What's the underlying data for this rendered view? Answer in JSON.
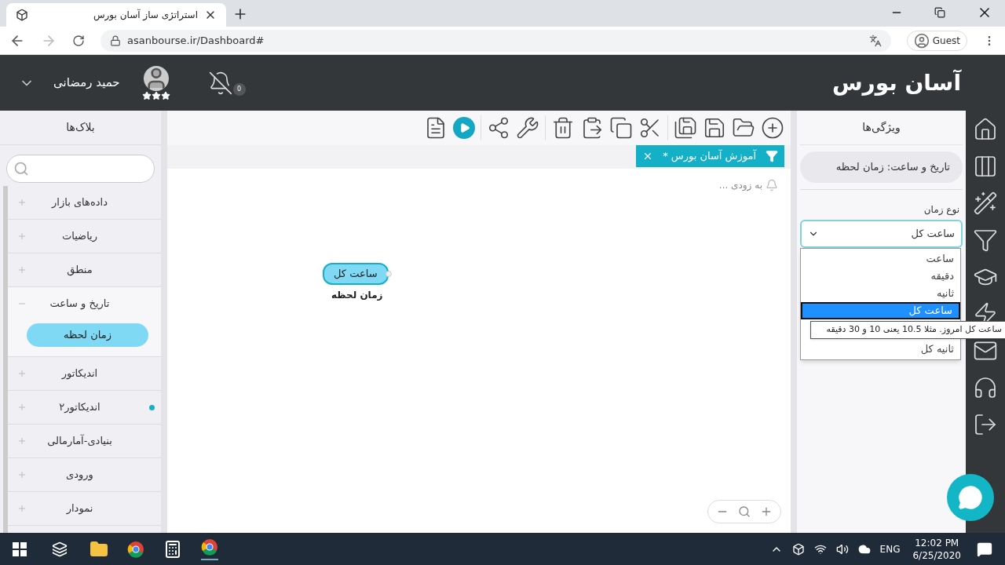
{
  "browser": {
    "tab_title": "استراتژی ساز آسان بورس",
    "url": "asanbourse.ir/Dashboard#",
    "profile": "Guest"
  },
  "header": {
    "logo": "آسان بورس",
    "user_name": "حمید رمضانی",
    "stars": 3,
    "notification_count": "0"
  },
  "blocks_panel": {
    "title": "بلاک‌ها",
    "categories": [
      {
        "label": "داده‌های بازار",
        "expanded": false,
        "marked": false
      },
      {
        "label": "ریاضیات",
        "expanded": false,
        "marked": false
      },
      {
        "label": "منطق",
        "expanded": false,
        "marked": false
      },
      {
        "label": "تاریخ و ساعت",
        "expanded": true,
        "marked": false,
        "children": [
          {
            "label": "زمان لحظه"
          }
        ]
      },
      {
        "label": "اندیکاتور",
        "expanded": false,
        "marked": false
      },
      {
        "label": "اندیکاتور۲",
        "expanded": false,
        "marked": true
      },
      {
        "label": "بنیادی-آمارمالی",
        "expanded": false,
        "marked": false
      },
      {
        "label": "ورودی",
        "expanded": false,
        "marked": false
      },
      {
        "label": "نمودار",
        "expanded": false,
        "marked": false
      }
    ]
  },
  "document_tab": {
    "title": "آموزش آسان بورس *"
  },
  "canvas": {
    "hint": "به زودی ...",
    "node": {
      "value": "ساعت کل",
      "caption": "زمان لحظه"
    }
  },
  "properties": {
    "title": "ویژگی‌ها",
    "block": "تاریخ و ساعت: زمان لحظه",
    "field_label": "نوع زمان",
    "select": {
      "value": "ساعت کل",
      "expanded": true,
      "options": [
        {
          "label": "ساعت",
          "selected": false
        },
        {
          "label": "دقیقه",
          "selected": false
        },
        {
          "label": "ثانیه",
          "selected": false
        },
        {
          "label": "ساعت کل",
          "selected": true
        },
        {
          "label": "ثانیه کل",
          "selected": false
        }
      ]
    },
    "tooltip": "ساعت کل امروز. مثلا 10.5 یعنی 10 و 30 دقیقه"
  },
  "taskbar": {
    "language": "ENG",
    "time": "12:02 PM",
    "date": "6/25/2020"
  }
}
